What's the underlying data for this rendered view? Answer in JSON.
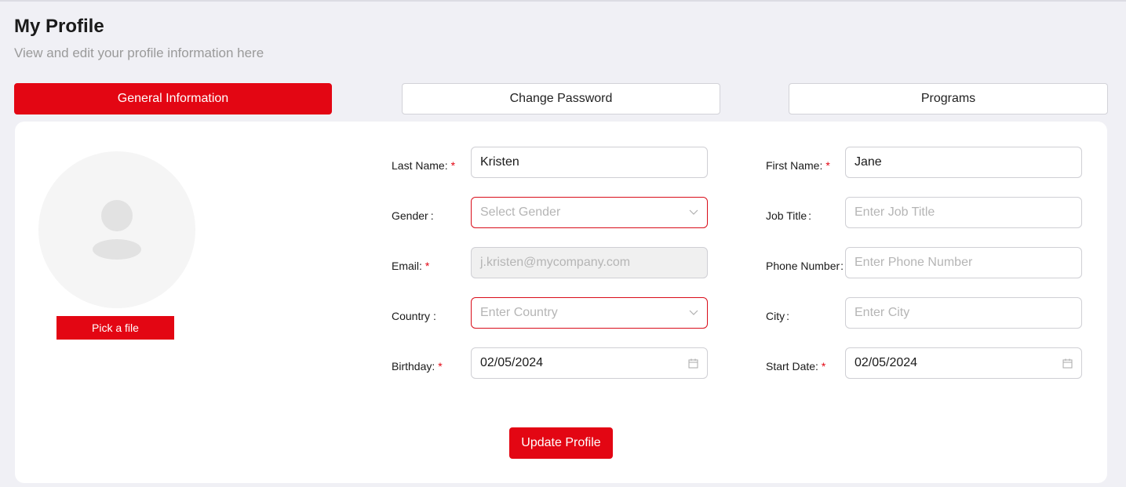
{
  "header": {
    "title": "My Profile",
    "subtitle": "View and edit your profile information here"
  },
  "tabs": [
    {
      "label": "General Information",
      "active": true
    },
    {
      "label": "Change Password",
      "active": false
    },
    {
      "label": "Programs",
      "active": false
    }
  ],
  "avatar": {
    "icon": "user-placeholder-icon",
    "pick_label": "Pick a file"
  },
  "form": {
    "last_name": {
      "label": "Last Name:",
      "required": true,
      "value": "Kristen",
      "placeholder": ""
    },
    "first_name": {
      "label": "First Name:",
      "required": true,
      "value": "Jane",
      "placeholder": ""
    },
    "gender": {
      "label": "Gender",
      "suffix": ":",
      "required": false,
      "value": "",
      "placeholder": "Select Gender"
    },
    "job_title": {
      "label": "Job Title",
      "suffix": ":",
      "required": false,
      "value": "",
      "placeholder": "Enter Job Title"
    },
    "email": {
      "label": "Email:",
      "required": true,
      "value": "j.kristen@mycompany.com",
      "disabled": true
    },
    "phone": {
      "label": "Phone Number",
      "suffix": ":",
      "required": false,
      "value": "",
      "placeholder": "Enter Phone Number"
    },
    "country": {
      "label": "Country",
      "suffix": ":",
      "required": false,
      "value": "",
      "placeholder": "Enter Country"
    },
    "city": {
      "label": "City",
      "suffix": ":",
      "required": false,
      "value": "",
      "placeholder": "Enter City"
    },
    "birthday": {
      "label": "Birthday:",
      "required": true,
      "value": "02/05/2024"
    },
    "start_date": {
      "label": "Start Date:",
      "required": true,
      "value": "02/05/2024"
    },
    "required_mark": "*"
  },
  "actions": {
    "update_label": "Update Profile"
  },
  "colors": {
    "accent": "#e30613",
    "background": "#f0f0f5",
    "card": "#ffffff",
    "error_border": "#d90d1a",
    "placeholder": "#b5b5b5"
  }
}
